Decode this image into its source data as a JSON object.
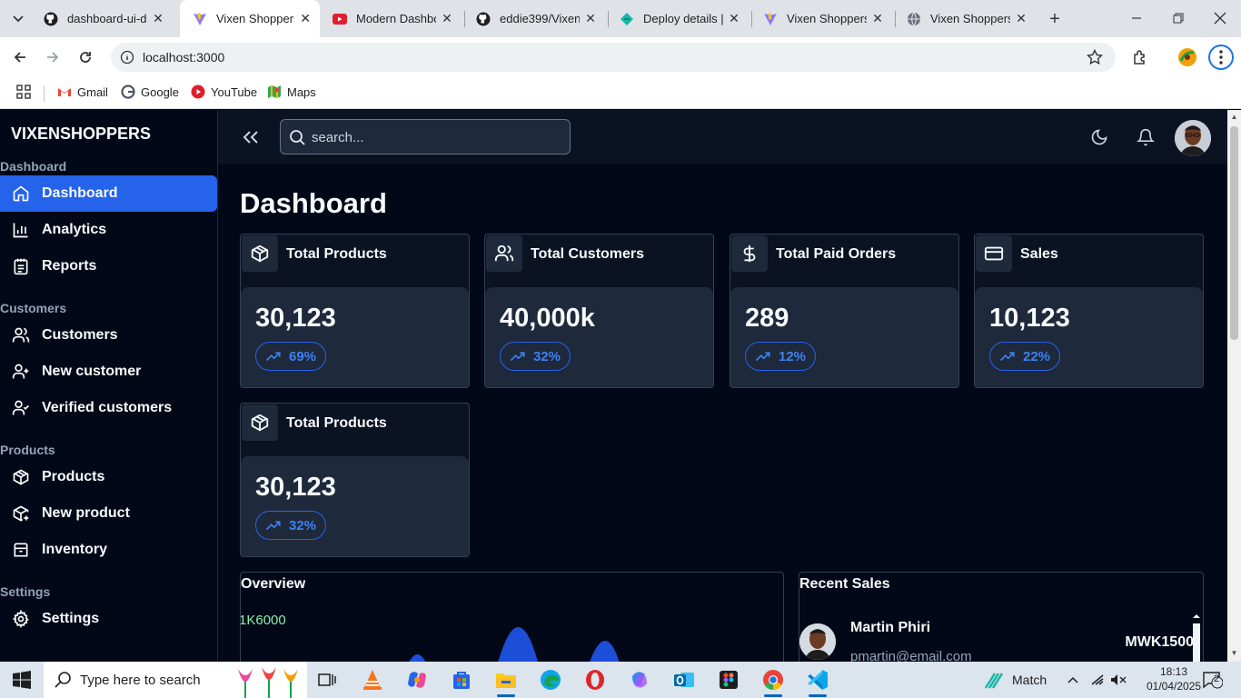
{
  "browser": {
    "tabs": [
      {
        "label": "dashboard-ui-de",
        "icon": "github-icon"
      },
      {
        "label": "Vixen Shoppers",
        "icon": "vite-icon",
        "active": true
      },
      {
        "label": "Modern Dashbo",
        "icon": "youtube-icon"
      },
      {
        "label": "eddie399/Vixen",
        "icon": "github-icon"
      },
      {
        "label": "Deploy details |",
        "icon": "netlify-icon"
      },
      {
        "label": "Vixen Shoppers",
        "icon": "vite-icon"
      },
      {
        "label": "Vixen Shoppers",
        "icon": "globe-icon"
      }
    ],
    "url": "localhost:3000",
    "bookmarks": [
      {
        "label": "Gmail",
        "icon": "gmail-icon"
      },
      {
        "label": "Google",
        "icon": "google-icon"
      },
      {
        "label": "YouTube",
        "icon": "youtube-icon"
      },
      {
        "label": "Maps",
        "icon": "maps-icon"
      }
    ]
  },
  "sidebar": {
    "brand": "VIXENSHOPPERS",
    "sections": [
      {
        "title": "Dashboard",
        "items": [
          {
            "label": "Dashboard",
            "icon": "home-icon",
            "active": true
          },
          {
            "label": "Analytics",
            "icon": "bar-chart-icon"
          },
          {
            "label": "Reports",
            "icon": "notepad-icon"
          }
        ]
      },
      {
        "title": "Customers",
        "items": [
          {
            "label": "Customers",
            "icon": "users-icon"
          },
          {
            "label": "New customer",
            "icon": "user-plus-icon"
          },
          {
            "label": "Verified customers",
            "icon": "user-check-icon"
          }
        ]
      },
      {
        "title": "Products",
        "items": [
          {
            "label": "Products",
            "icon": "package-icon"
          },
          {
            "label": "New product",
            "icon": "package-plus-icon"
          },
          {
            "label": "Inventory",
            "icon": "inventory-icon"
          }
        ]
      },
      {
        "title": "Settings",
        "items": [
          {
            "label": "Settings",
            "icon": "gear-icon"
          }
        ]
      }
    ]
  },
  "topbar": {
    "search_placeholder": "search..."
  },
  "main": {
    "title": "Dashboard",
    "cards": [
      {
        "title": "Total Products",
        "value": "30,123",
        "change": "69%",
        "icon": "package-icon"
      },
      {
        "title": "Total Customers",
        "value": "40,000k",
        "change": "32%",
        "icon": "users-icon"
      },
      {
        "title": "Total Paid Orders",
        "value": "289",
        "change": "12%",
        "icon": "dollar-icon"
      },
      {
        "title": "Sales",
        "value": "10,123",
        "change": "22%",
        "icon": "credit-card-icon"
      },
      {
        "title": "Total Products",
        "value": "30,123",
        "change": "32%",
        "icon": "package-icon"
      }
    ],
    "overview": {
      "title": "Overview",
      "tick": "1K6000"
    },
    "recent_sales": {
      "title": "Recent Sales",
      "items": [
        {
          "name": "Martin Phiri",
          "email": "pmartin@email.com",
          "amount": "MWK1500"
        }
      ]
    }
  },
  "taskbar": {
    "search_placeholder": "Type here to search",
    "weather": "Match",
    "time": "18:13",
    "date": "01/04/2025",
    "notifications": "2"
  },
  "colors": {
    "accent": "#2563eb",
    "background": "#020817",
    "card": "#1e293b"
  }
}
